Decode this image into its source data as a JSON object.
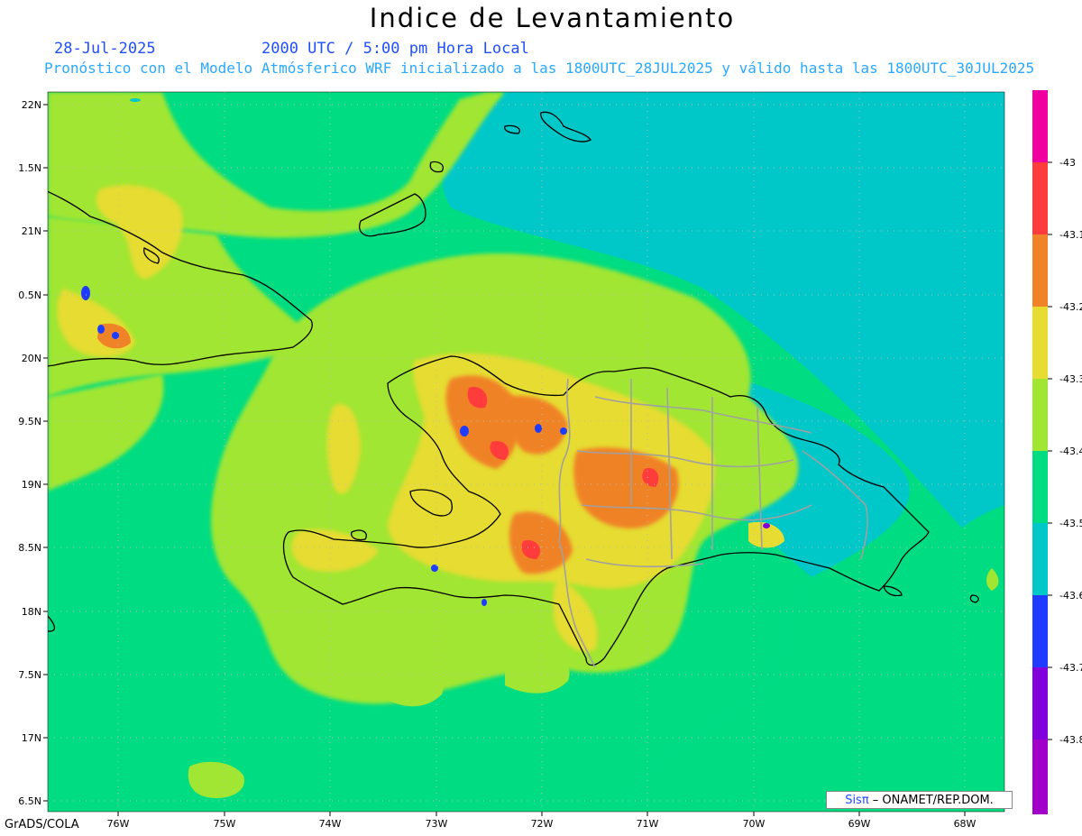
{
  "title": "Indice de Levantamiento",
  "date_label": "28-Jul-2025",
  "time_label": "2000 UTC / 5:00 pm Hora Local",
  "model_line": "Pronóstico con el Modelo Atmósferico WRF inicializado a las 1800UTC_28JUL2025 y válido hasta las  1800UTC_30JUL2025",
  "credit": {
    "brand": "Sisπ",
    "text": " – ONAMET/REP.DOM."
  },
  "footer": "GrADS/COLA",
  "map": {
    "lat_labels": [
      "22N",
      "1.5N",
      "21N",
      "0.5N",
      "20N",
      "9.5N",
      "19N",
      "8.5N",
      "18N",
      "7.5N",
      "17N",
      "6.5N"
    ],
    "lon_labels": [
      "76W",
      "75W",
      "74W",
      "73W",
      "72W",
      "71W",
      "70W",
      "69W",
      "68W"
    ],
    "background_color": "#00c8c8"
  },
  "colorbar": {
    "labels": [
      "-43",
      "-43.1",
      "-43.2",
      "-43.3",
      "-43.4",
      "-43.5",
      "-43.6",
      "-43.7",
      "-43.8"
    ],
    "colors": [
      "#f000a0",
      "#ff3c3c",
      "#f08228",
      "#e6dc32",
      "#a0e632",
      "#00dc82",
      "#00c8c8",
      "#1e3cff",
      "#8200dc",
      "#a000c8"
    ]
  }
}
